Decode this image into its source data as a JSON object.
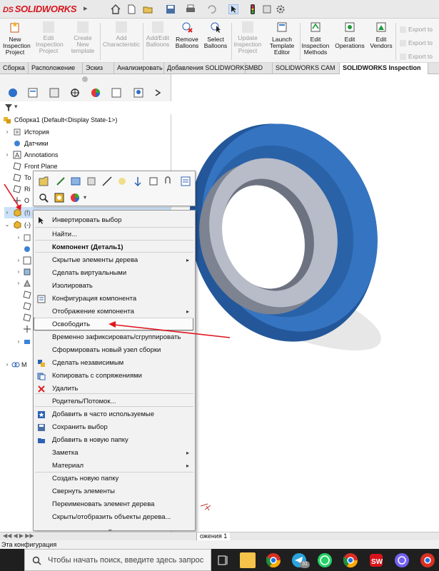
{
  "app": {
    "logo": "SOLIDWORKS",
    "logo_ds": "DS"
  },
  "ribbon": {
    "buttons": [
      {
        "label": "New\nInspection\nProject",
        "disabled": false
      },
      {
        "label": "Edit\nInspection\nProject",
        "disabled": true
      },
      {
        "label": "Create\nNew\ntemplate",
        "disabled": true
      },
      {
        "label": "Add\nCharacteristic",
        "disabled": true
      },
      {
        "label": "Add/Edit\nBalloons",
        "disabled": true
      },
      {
        "label": "Remove\nBalloons",
        "disabled": false
      },
      {
        "label": "Select\nBalloons",
        "disabled": false
      },
      {
        "label": "Update\nInspection\nProject",
        "disabled": true
      },
      {
        "label": "Launch\nTemplate\nEditor",
        "disabled": false
      },
      {
        "label": "Edit\nInspection\nMethods",
        "disabled": false
      },
      {
        "label": "Edit\nOperations",
        "disabled": false
      },
      {
        "label": "Edit\nVendors",
        "disabled": false
      }
    ],
    "export": [
      "Export to",
      "Export to",
      "Export to"
    ]
  },
  "tabs": [
    "Сборка",
    "Расположение",
    "Эскиз",
    "Анализировать",
    "Добавления SOLIDWORKS",
    "MBD",
    "SOLIDWORKS CAM",
    "SOLIDWORKS Inspection"
  ],
  "tree": {
    "root": "Сборка1  (Default<Display State-1>)",
    "items": [
      "История",
      "Датчики",
      "Annotations",
      "Front Plane",
      "To",
      "Ri",
      "O",
      "(f) ... (Default<Default>_Display State-1",
      "(-)"
    ],
    "bottom_label": "M"
  },
  "context_menu": {
    "items": [
      {
        "label": "Инвертировать выбор",
        "icon": "cursor-icon",
        "arrow": false
      },
      {
        "label": "Найти...",
        "icon": "",
        "arrow": false
      },
      {
        "label": "Компонент (Деталь1)",
        "icon": "",
        "arrow": false,
        "header": true
      },
      {
        "label": "Скрытые элементы дерева",
        "icon": "",
        "arrow": true
      },
      {
        "label": "Сделать виртуальными",
        "icon": "",
        "arrow": false
      },
      {
        "label": "Изолировать",
        "icon": "",
        "arrow": false
      },
      {
        "label": "Конфигурация компонента",
        "icon": "config-icon",
        "arrow": false
      },
      {
        "label": "Отображение компонента",
        "icon": "",
        "arrow": true
      },
      {
        "label": "Освободить",
        "icon": "",
        "arrow": false,
        "highlighted": true
      },
      {
        "label": "Временно зафиксировать/сгруппировать",
        "icon": "",
        "arrow": false
      },
      {
        "label": "Сформировать новый узел сборки",
        "icon": "",
        "arrow": false
      },
      {
        "label": "Сделать независимым",
        "icon": "independent-icon",
        "arrow": false
      },
      {
        "label": "Копировать с сопряжениями",
        "icon": "copy-mates-icon",
        "arrow": false
      },
      {
        "label": "Удалить",
        "icon": "delete-icon",
        "arrow": false
      },
      {
        "label": "Родитель/Потомок...",
        "icon": "",
        "arrow": false
      },
      {
        "label": "Добавить в часто используемые",
        "icon": "favorite-icon",
        "arrow": false
      },
      {
        "label": "Сохранить выбор",
        "icon": "save-selection-icon",
        "arrow": false
      },
      {
        "label": "Добавить в новую папку",
        "icon": "folder-icon",
        "arrow": false
      },
      {
        "label": "Заметка",
        "icon": "",
        "arrow": true
      },
      {
        "label": "Материал",
        "icon": "",
        "arrow": true
      },
      {
        "label": "Создать новую папку",
        "icon": "",
        "arrow": false
      },
      {
        "label": "Свернуть элементы",
        "icon": "",
        "arrow": false
      },
      {
        "label": "Переименовать элемент дерева",
        "icon": "",
        "arrow": false
      },
      {
        "label": "Скрыть/отобразить объекты дерева...",
        "icon": "",
        "arrow": false
      }
    ],
    "more": "⌄"
  },
  "bottom_tab": "ожения 1",
  "status": {
    "text": "Эта конфигурация"
  },
  "taskbar": {
    "search_placeholder": "Чтобы начать поиск, введите здесь запрос",
    "badge": "31"
  },
  "colors": {
    "arrow": "#e0141e",
    "part_blue": "#2f6db4",
    "ring_grey": "#9ea4b1",
    "logo_red": "#d8141a"
  }
}
